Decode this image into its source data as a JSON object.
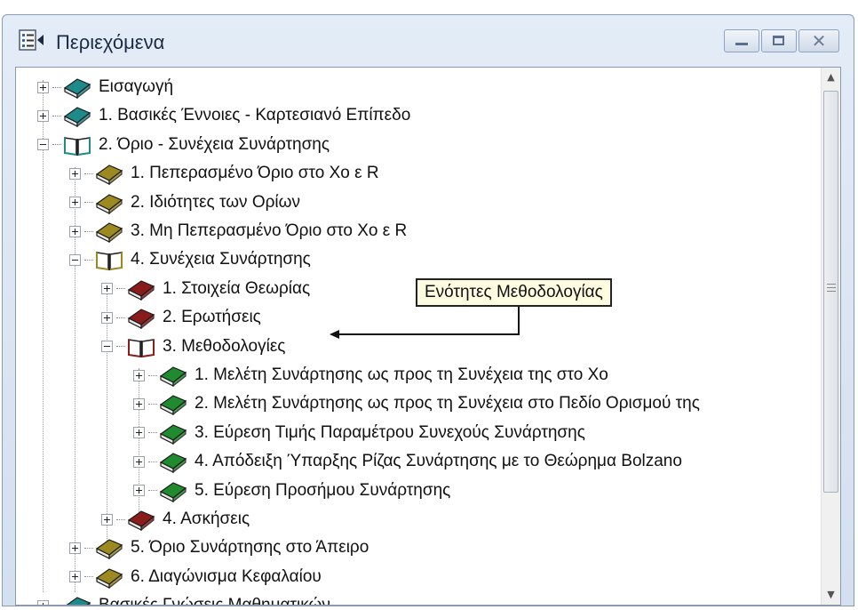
{
  "window": {
    "title": "Περιεχόμενα",
    "icons": {
      "title": "contents-list-icon",
      "minimize": "minimize-icon",
      "maximize": "maximize-icon",
      "close": "close-icon"
    }
  },
  "tree": {
    "items": [
      {
        "id": "intro",
        "label": "Εισαγωγή",
        "expander": "plus",
        "book": "closed",
        "book_color": "#1f8a8a"
      },
      {
        "id": "basic-concepts",
        "label": "1.  Βασικές Έννοιες - Καρτεσιανό Επίπεδο",
        "expander": "plus",
        "book": "closed",
        "book_color": "#1f8a8a"
      },
      {
        "id": "limit-continuity",
        "label": "2.  Όριο - Συνέχεια Συνάρτησης",
        "expander": "minus",
        "book": "open",
        "book_color": "#1f8a8a"
      },
      {
        "id": "finite-limit",
        "label": "1.  Πεπερασμένο Όριο στο Χο ε R",
        "expander": "plus",
        "book": "closed",
        "book_color": "#9c8a20"
      },
      {
        "id": "limit-properties",
        "label": "2.  Ιδιότητες των Ορίων",
        "expander": "plus",
        "book": "closed",
        "book_color": "#9c8a20"
      },
      {
        "id": "infinite-limit",
        "label": "3.  Μη Πεπερασμένο Όριο στο Χο ε R",
        "expander": "plus",
        "book": "closed",
        "book_color": "#9c8a20"
      },
      {
        "id": "continuity",
        "label": "4.  Συνέχεια Συνάρτησης",
        "expander": "minus",
        "book": "open",
        "book_color": "#9c8a20"
      },
      {
        "id": "theory",
        "label": "1.  Στοιχεία Θεωρίας",
        "expander": "plus",
        "book": "closed",
        "book_color": "#8a1c1c"
      },
      {
        "id": "questions",
        "label": "2.  Ερωτήσεις",
        "expander": "plus",
        "book": "closed",
        "book_color": "#8a1c1c"
      },
      {
        "id": "methodologies",
        "label": "3.  Μεθοδολογίες",
        "expander": "minus",
        "book": "open",
        "book_color": "#8a1c1c"
      },
      {
        "id": "m1",
        "label": "1.  Μελέτη Συνάρτησης ως προς τη Συνέχεια της στο Χο",
        "expander": "plus",
        "book": "closed",
        "book_color": "#1f8a2e"
      },
      {
        "id": "m2",
        "label": "2.  Μελέτη Συνάρτησης ως προς τη Συνέχεια στο Πεδίο Ορισμού της",
        "expander": "plus",
        "book": "closed",
        "book_color": "#1f8a2e"
      },
      {
        "id": "m3",
        "label": "3.  Εύρεση Τιμής Παραμέτρου Συνεχούς Συνάρτησης",
        "expander": "plus",
        "book": "closed",
        "book_color": "#1f8a2e"
      },
      {
        "id": "m4",
        "label": "4.  Απόδειξη Ύπαρξης Ρίζας Συνάρτησης με το Θεώρημα Bolzano",
        "expander": "plus",
        "book": "closed",
        "book_color": "#1f8a2e"
      },
      {
        "id": "m5",
        "label": "5.  Εύρεση Προσήμου Συνάρτησης",
        "expander": "plus",
        "book": "closed",
        "book_color": "#1f8a2e"
      },
      {
        "id": "exercises",
        "label": "4.  Ασκήσεις",
        "expander": "plus",
        "book": "closed",
        "book_color": "#8a1c1c"
      },
      {
        "id": "limit-infinity",
        "label": "5.  Όριο Συνάρτησης στο Άπειρο",
        "expander": "plus",
        "book": "closed",
        "book_color": "#9c8a20"
      },
      {
        "id": "chapter-test",
        "label": "6.  Διαγώνισμα Κεφαλαίου",
        "expander": "plus",
        "book": "closed",
        "book_color": "#9c8a20"
      },
      {
        "id": "basic-knowledge",
        "label": "Βασικές Γνώσεις Μαθηματικών",
        "expander": "plus",
        "book": "closed",
        "book_color": "#1f8a8a"
      }
    ]
  },
  "callout": {
    "text": "Ενότητες Μεθοδολογίας"
  },
  "scrollbar": {
    "up_icon": "scroll-up-icon",
    "down_icon": "scroll-down-icon",
    "thumb_icon": "scroll-grip-icon"
  }
}
